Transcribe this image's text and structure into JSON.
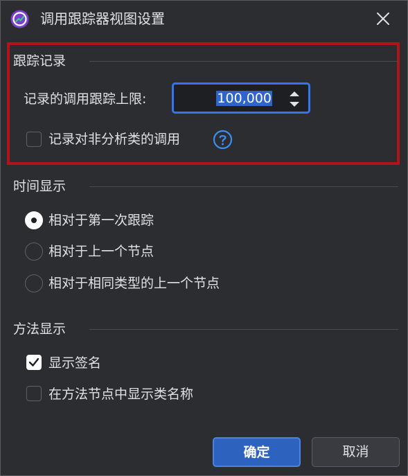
{
  "window": {
    "title": "调用跟踪器视图设置",
    "app_icon": "profiler-app-icon",
    "close_icon": "close-icon"
  },
  "trace_section": {
    "title": "跟踪记录",
    "limit_label": "记录的调用跟踪上限:",
    "limit_value": "100,000",
    "record_unanalyzed_label": "记录对非分析类的调用",
    "record_unanalyzed_checked": false,
    "help_icon": "help-icon"
  },
  "time_section": {
    "title": "时间显示",
    "options": [
      {
        "label": "相对于第一次跟踪",
        "selected": true
      },
      {
        "label": "相对于上一个节点",
        "selected": false
      },
      {
        "label": "相对于相同类型的上一个节点",
        "selected": false
      }
    ]
  },
  "method_section": {
    "title": "方法显示",
    "show_signature_label": "显示签名",
    "show_signature_checked": true,
    "show_class_name_label": "在方法节点中显示类名称",
    "show_class_name_checked": false
  },
  "buttons": {
    "ok": "确定",
    "cancel": "取消"
  },
  "colors": {
    "background": "#2b2d30",
    "accent": "#3574f0",
    "highlight_border": "#b0141a",
    "text": "#dfe1e5"
  }
}
